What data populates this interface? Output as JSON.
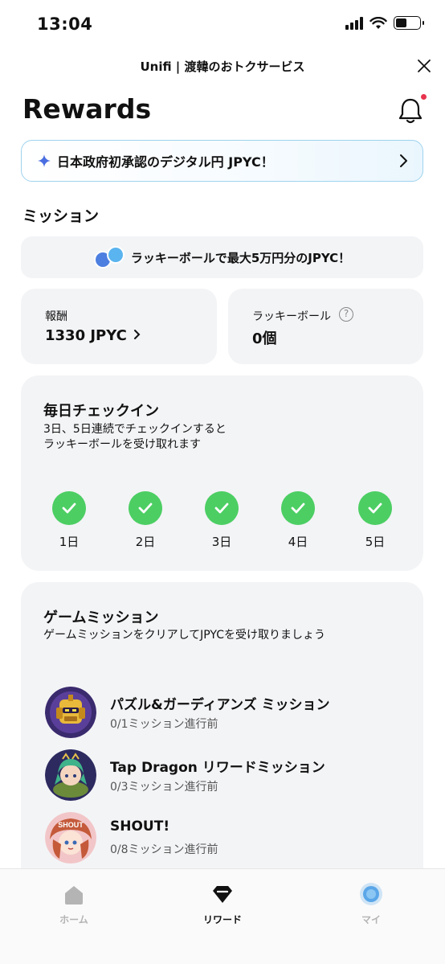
{
  "status_bar": {
    "time": "13:04"
  },
  "header": {
    "title": "Unifi | 渡韓のおトクサービス"
  },
  "page": {
    "title": "Rewards"
  },
  "banner": {
    "text": "日本政府初承認のデジタル円 JPYC！"
  },
  "missions": {
    "section_title": "ミッション",
    "lucky_banner": "ラッキーボールで最大5万円分のJPYC！",
    "reward": {
      "label": "報酬",
      "value": "1330 JPYC"
    },
    "lucky_ball": {
      "label": "ラッキーボール",
      "value": "0個"
    }
  },
  "checkin": {
    "title": "毎日チェックイン",
    "desc_line1": "3日、5日連続でチェックインすると",
    "desc_line2": "ラッキーボールを受け取れます",
    "days": [
      "1日",
      "2日",
      "3日",
      "4日",
      "5日"
    ],
    "check_color": "#4cce63"
  },
  "game_missions": {
    "title": "ゲームミッション",
    "desc": "ゲームミッションをクリアしてJPYCを受け取りましょう",
    "items": [
      {
        "name": "パズル&ガーディアンズ ミッション",
        "status": "0/1ミッション進行前"
      },
      {
        "name": "Tap Dragon リワードミッション",
        "status": "0/3ミッション進行前"
      },
      {
        "name": "SHOUT!",
        "status": "0/8ミッション進行前",
        "avatar_text": "SHOUT"
      }
    ]
  },
  "nav": {
    "home": "ホーム",
    "rewards": "リワード",
    "my": "マイ"
  },
  "colors": {
    "accent_blue": "#4d7fe0",
    "banner_border": "#9ed3ee",
    "notification_dot": "#e8344d"
  }
}
